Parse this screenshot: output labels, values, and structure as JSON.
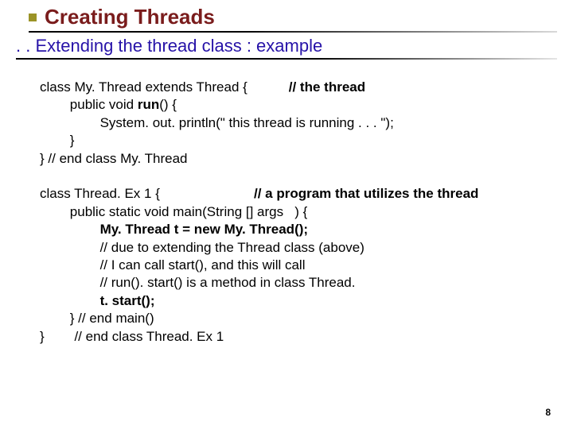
{
  "header": {
    "title": "Creating Threads",
    "subtitle": ". . Extending the thread class : example"
  },
  "code": {
    "block1": {
      "l1a": "class My. Thread extends Thread {           ",
      "l1b": "// the thread",
      "l2a": "        public void ",
      "l2b": "run",
      "l2c": "() {",
      "l3": "                System. out. println(\" this thread is running . . . \");",
      "l4": "        }",
      "l5": "} // end class My. Thread"
    },
    "block2": {
      "l1a": "class Thread. Ex 1 {                         ",
      "l1b": "// a program that utilizes the thread",
      "l2": "        public static void main(String [] args   ) {",
      "l3": "                My. Thread t = new My. Thread();",
      "l4": "                // due to extending the Thread class (above)",
      "l5": "                // I can call start(), and this will call",
      "l6": "                // run(). start() is a method in class Thread.",
      "l7": "                t. start();",
      "l8": "        } // end main()",
      "l9": "}        // end class Thread. Ex 1"
    }
  },
  "page_number": "8"
}
